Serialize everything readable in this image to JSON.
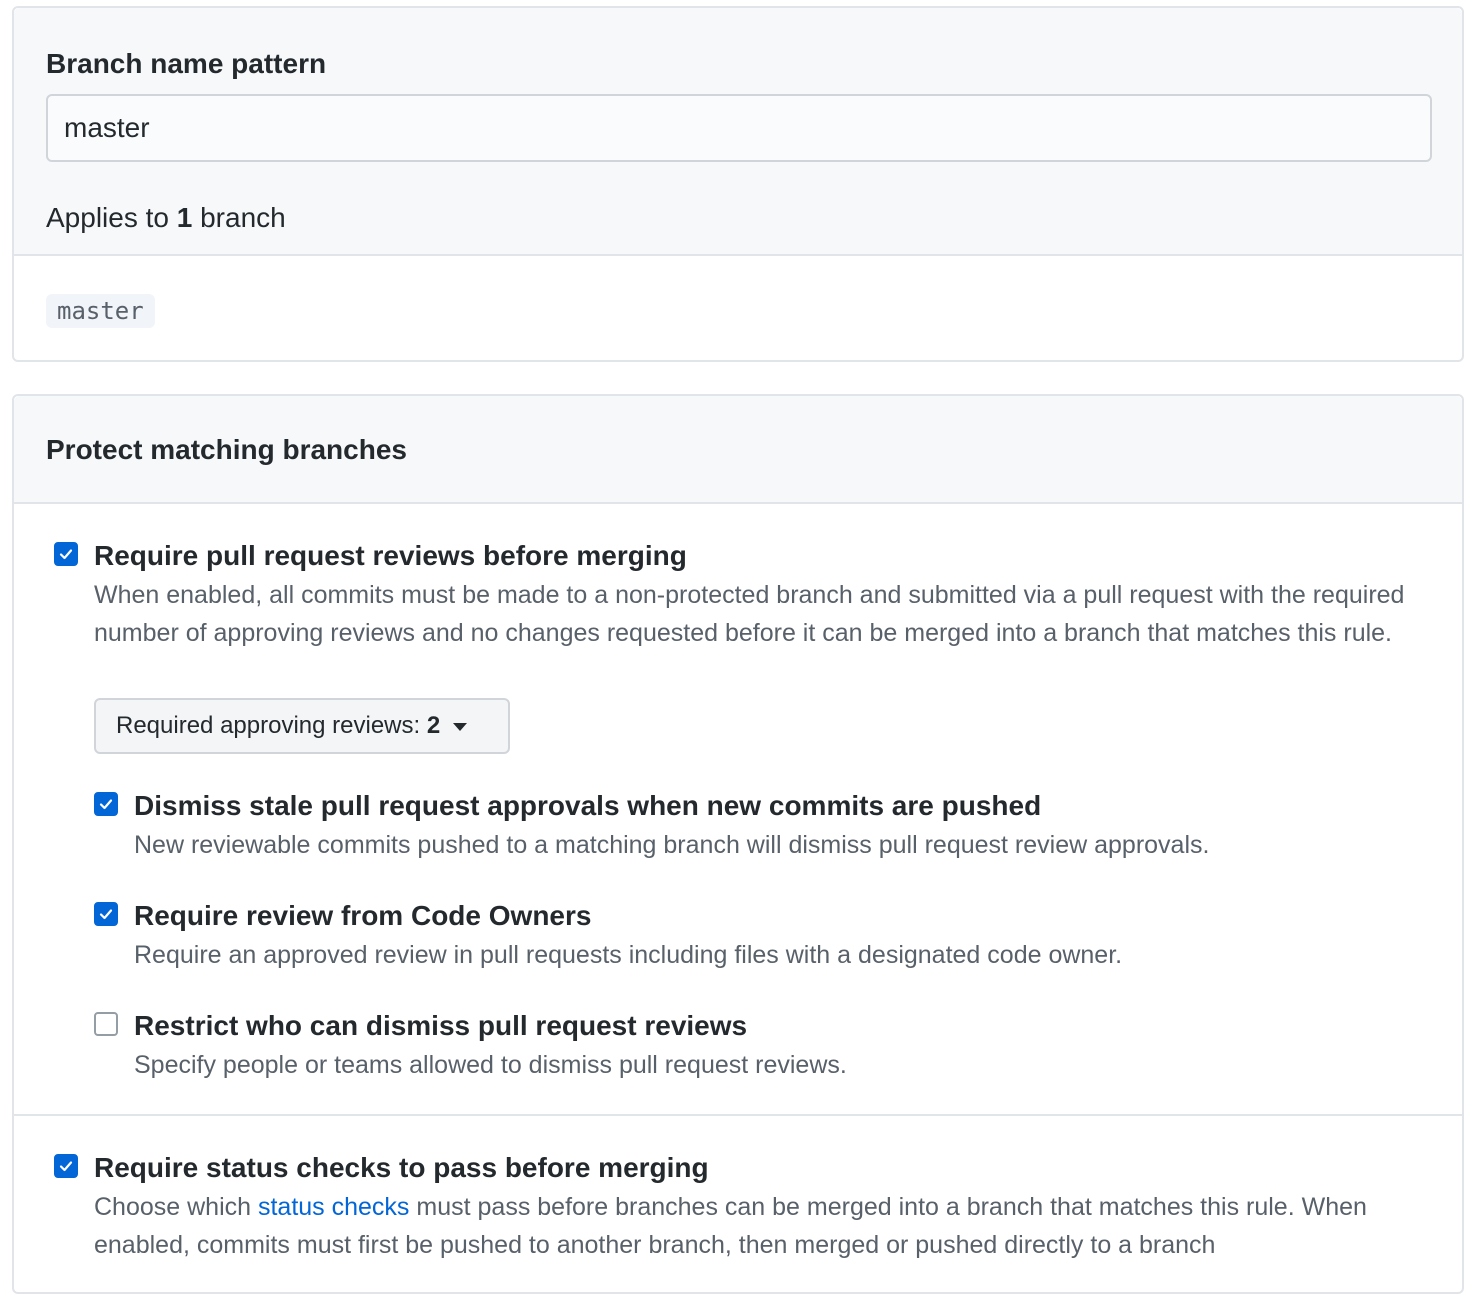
{
  "pattern_section": {
    "label": "Branch name pattern",
    "input_value": "master",
    "applies_prefix": "Applies to",
    "applies_count": "1",
    "applies_suffix": "branch",
    "branches": [
      "master"
    ]
  },
  "protect_section": {
    "title": "Protect matching branches",
    "options": [
      {
        "title": "Require pull request reviews before merging",
        "checked": true,
        "description": "When enabled, all commits must be made to a non-protected branch and submitted via a pull request with the required number of approving reviews and no changes requested before it can be merged into a branch that matches this rule.",
        "select_label": "Required approving reviews:",
        "select_value": "2",
        "sub_options": [
          {
            "title": "Dismiss stale pull request approvals when new commits are pushed",
            "checked": true,
            "description": "New reviewable commits pushed to a matching branch will dismiss pull request review approvals."
          },
          {
            "title": "Require review from Code Owners",
            "checked": true,
            "description": "Require an approved review in pull requests including files with a designated code owner."
          },
          {
            "title": "Restrict who can dismiss pull request reviews",
            "checked": false,
            "description": "Specify people or teams allowed to dismiss pull request reviews."
          }
        ]
      },
      {
        "title": "Require status checks to pass before merging",
        "checked": true,
        "description_prefix": "Choose which",
        "description_link": "status checks",
        "description_suffix": "must pass before branches can be merged into a branch that matches this rule. When enabled, commits must first be pushed to another branch, then merged or pushed directly to a branch"
      }
    ]
  },
  "colors": {
    "accent": "#0366d6",
    "border": "#e1e4e8",
    "muted_text": "#586069",
    "header_bg": "#f6f8fa"
  },
  "icons": {
    "checked": "check-icon",
    "dropdown": "caret-down-icon"
  }
}
